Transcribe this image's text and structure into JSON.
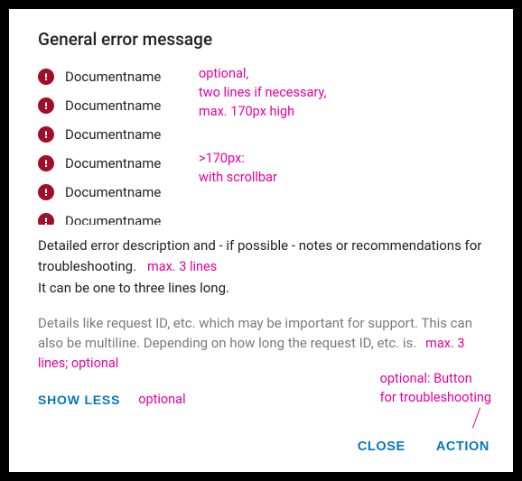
{
  "title": "General error message",
  "documents": [
    "Documentname",
    "Documentname",
    "Documentname",
    "Documentname",
    "Documentname",
    "Documentname"
  ],
  "annotations": {
    "doclist1": "optional,\ntwo lines if necessary,\nmax. 170px high",
    "doclist2": ">170px:\nwith scrollbar",
    "desc_inline": "max. 3 lines",
    "support_inline": "max. 3 lines; optional",
    "toggle": "optional",
    "action": "optional: Button\nfor troubleshooting"
  },
  "description": {
    "line1a": "Detailed error description and - if possible - notes or recommendations for troubleshooting.",
    "line2": "It can be one to three lines long."
  },
  "support": {
    "text": "Details like request ID, etc. which may be important for support. This can also be multiline. Depending on how long the request ID, etc. is."
  },
  "toggle_label": "SHOW LESS",
  "buttons": {
    "close": "CLOSE",
    "action": "ACTION"
  }
}
